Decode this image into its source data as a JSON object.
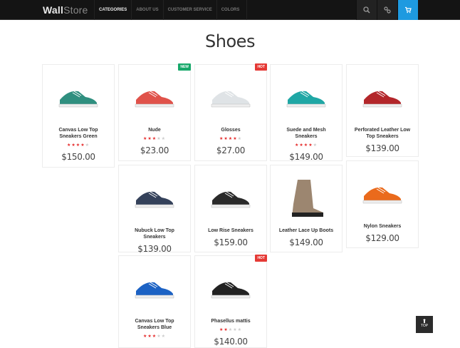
{
  "header": {
    "logo_bold": "Wall",
    "logo_rest": "Store",
    "menu": [
      "Categories",
      "About Us",
      "Customer Service",
      "Colors"
    ],
    "active_index": 0,
    "icons": [
      "search-icon",
      "link-icon",
      "cart-icon"
    ],
    "accent": "#1e9ae0"
  },
  "page_title": "Shoes",
  "products": [
    {
      "name": "Canvas Low Top Sneakers Green",
      "rating": 4,
      "price": "$150.00",
      "badge": null,
      "color": "#2f8f7f"
    },
    {
      "name": "Nude",
      "rating": 3,
      "price": "$23.00",
      "badge": "NEW",
      "color": "#e0524a"
    },
    {
      "name": "Glosses",
      "rating": 4,
      "price": "$27.00",
      "badge": "HOT",
      "color": "#dfe3e6"
    },
    {
      "name": "Suede and Mesh Sneakers",
      "rating": 4,
      "price": "$149.00",
      "badge": null,
      "color": "#1fa7a5"
    },
    {
      "name": "Perforated Leather Low Top Sneakers",
      "rating": null,
      "price": "$139.00",
      "badge": null,
      "color": "#b3262a"
    },
    {
      "name": "Nubuck Low Top Sneakers",
      "rating": null,
      "price": "$139.00",
      "badge": null,
      "color": "#34415a"
    },
    {
      "name": "Low Rise Sneakers",
      "rating": null,
      "price": "$159.00",
      "badge": null,
      "color": "#2a2a2a"
    },
    {
      "name": "Leather Lace Up Boots",
      "rating": null,
      "price": "$149.00",
      "badge": null,
      "color": "#9c8670"
    },
    {
      "name": "Nylon Sneakers",
      "rating": null,
      "price": "$129.00",
      "badge": null,
      "color": "#ea6a1c"
    },
    {
      "name": "Canvas Low Top Sneakers Blue",
      "rating": 3,
      "price": "",
      "badge": null,
      "color": "#1c62c4"
    },
    {
      "name": "Phasellus mattis",
      "rating": 2,
      "price": "$140.00",
      "badge": "HOT",
      "color": "#222222"
    }
  ],
  "badge_colors": {
    "NEW": "#17a86a",
    "HOT": "#e53935"
  },
  "back_to_top": "TOP"
}
